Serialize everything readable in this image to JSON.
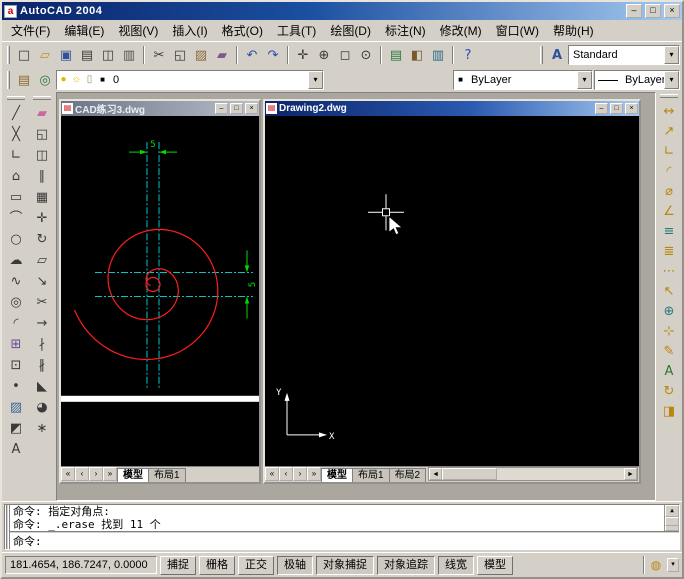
{
  "titlebar": {
    "title": "AutoCAD 2004",
    "icon_letter": "a",
    "min_glyph": "–",
    "restore_glyph": "□",
    "close_glyph": "×"
  },
  "menu": {
    "items": [
      {
        "n": "menu-file",
        "label": "文件(F)"
      },
      {
        "n": "menu-edit",
        "label": "编辑(E)"
      },
      {
        "n": "menu-view",
        "label": "视图(V)"
      },
      {
        "n": "menu-insert",
        "label": "插入(I)"
      },
      {
        "n": "menu-format",
        "label": "格式(O)"
      },
      {
        "n": "menu-tools",
        "label": "工具(T)"
      },
      {
        "n": "menu-draw",
        "label": "绘图(D)"
      },
      {
        "n": "menu-dimension",
        "label": "标注(N)"
      },
      {
        "n": "menu-modify",
        "label": "修改(M)"
      },
      {
        "n": "menu-window",
        "label": "窗口(W)"
      },
      {
        "n": "menu-help",
        "label": "帮助(H)"
      }
    ]
  },
  "standard_toolbar": [
    {
      "n": "qnew",
      "g": "□",
      "c": "#3a3a3a"
    },
    {
      "n": "open",
      "g": "▱",
      "c": "#c09020"
    },
    {
      "n": "save",
      "g": "▣",
      "c": "#31519b"
    },
    {
      "n": "plot",
      "g": "▤",
      "c": "#3a3a3a"
    },
    {
      "n": "plot-preview",
      "g": "◫",
      "c": "#3a3a3a"
    },
    {
      "n": "publish",
      "g": "▥",
      "c": "#555555"
    },
    {
      "sep": true
    },
    {
      "n": "cut",
      "g": "✂",
      "c": "#3a3a3a"
    },
    {
      "n": "copy-clip",
      "g": "◱",
      "c": "#3a3a3a"
    },
    {
      "n": "paste-clip",
      "g": "▨",
      "c": "#8a6d3b"
    },
    {
      "n": "match-properties",
      "g": "▰",
      "c": "#7a5a8a"
    },
    {
      "sep": true
    },
    {
      "n": "undo",
      "g": "↶",
      "c": "#2a4fb0"
    },
    {
      "n": "redo",
      "g": "↷",
      "c": "#2a4fb0"
    },
    {
      "sep": true
    },
    {
      "n": "pan-realtime",
      "g": "✛",
      "c": "#3a3a3a"
    },
    {
      "n": "zoom-realtime",
      "g": "⊕",
      "c": "#3a3a3a"
    },
    {
      "n": "zoom-window",
      "g": "◻",
      "c": "#3a3a3a"
    },
    {
      "n": "zoom-previous",
      "g": "⊙",
      "c": "#3a3a3a"
    },
    {
      "sep": true
    },
    {
      "n": "properties",
      "g": "▤",
      "c": "#2a7a3a"
    },
    {
      "n": "designcenter",
      "g": "◧",
      "c": "#7a5a2a"
    },
    {
      "n": "tool-palettes",
      "g": "▥",
      "c": "#2a6a8a"
    },
    {
      "sep": true
    },
    {
      "n": "help",
      "g": "?",
      "c": "#2a4fb0"
    }
  ],
  "styles_toolbar": {
    "text_style_glyph": "A",
    "value": "Standard",
    "arrow": "▾"
  },
  "layers_toolbar": {
    "layer_properties_glyph": "▤",
    "make_current_glyph": "◎",
    "bulb_glyph": "●",
    "sun_glyph": "☼",
    "lock_glyph": "▯",
    "swatch_glyph": "■",
    "current_layer": "0",
    "arrow": "▾"
  },
  "properties_toolbar": {
    "swatch_glyph": "■",
    "color_value": "ByLayer",
    "linetype_value": "ByLayer",
    "arrow": "▾"
  },
  "draw_toolbar": [
    {
      "n": "line",
      "g": "╱",
      "c": "#3a3a3a"
    },
    {
      "n": "construction-line",
      "g": "╳",
      "c": "#3a3a3a"
    },
    {
      "n": "polyline",
      "g": "∟",
      "c": "#3a3a3a"
    },
    {
      "n": "polygon",
      "g": "⌂",
      "c": "#3a3a3a"
    },
    {
      "n": "rectangle",
      "g": "▭",
      "c": "#3a3a3a"
    },
    {
      "n": "arc",
      "g": "⌒",
      "c": "#3a3a3a"
    },
    {
      "n": "circle",
      "g": "○",
      "c": "#3a3a3a"
    },
    {
      "n": "revision-cloud",
      "g": "☁",
      "c": "#3a3a3a"
    },
    {
      "n": "spline",
      "g": "∿",
      "c": "#3a3a3a"
    },
    {
      "n": "ellipse",
      "g": "◎",
      "c": "#3a3a3a"
    },
    {
      "n": "ellipse-arc",
      "g": "◜",
      "c": "#3a3a3a"
    },
    {
      "n": "insert-block",
      "g": "⊞",
      "c": "#6a4a9a"
    },
    {
      "n": "make-block",
      "g": "⊡",
      "c": "#3a3a3a"
    },
    {
      "n": "point",
      "g": "•",
      "c": "#3a3a3a"
    },
    {
      "n": "hatch",
      "g": "▨",
      "c": "#3a6a9a"
    },
    {
      "n": "region",
      "g": "◩",
      "c": "#3a3a3a"
    },
    {
      "n": "multiline-text",
      "g": "A",
      "c": "#3a3a3a"
    }
  ],
  "modify_toolbar": [
    {
      "n": "erase",
      "g": "▰",
      "c": "#c86a9a"
    },
    {
      "n": "copy-object",
      "g": "◱",
      "c": "#3a3a3a"
    },
    {
      "n": "mirror",
      "g": "◫",
      "c": "#3a3a3a"
    },
    {
      "n": "offset",
      "g": "∥",
      "c": "#3a3a3a"
    },
    {
      "n": "array",
      "g": "▦",
      "c": "#3a3a3a"
    },
    {
      "n": "move",
      "g": "✛",
      "c": "#3a3a3a"
    },
    {
      "n": "rotate",
      "g": "↻",
      "c": "#3a3a3a"
    },
    {
      "n": "scale",
      "g": "▱",
      "c": "#3a3a3a"
    },
    {
      "n": "stretch",
      "g": "↘",
      "c": "#3a3a3a"
    },
    {
      "n": "trim",
      "g": "✂",
      "c": "#3a3a3a"
    },
    {
      "n": "extend",
      "g": "→",
      "c": "#3a3a3a"
    },
    {
      "n": "break-at-point",
      "g": "∤",
      "c": "#3a3a3a"
    },
    {
      "n": "break",
      "g": "∦",
      "c": "#3a3a3a"
    },
    {
      "n": "chamfer",
      "g": "◣",
      "c": "#3a3a3a"
    },
    {
      "n": "fillet",
      "g": "◕",
      "c": "#3a3a3a"
    },
    {
      "n": "explode",
      "g": "∗",
      "c": "#3a3a3a"
    }
  ],
  "dimension_toolbar": [
    {
      "n": "linear-dimension",
      "g": "↔",
      "c": "#b8860b"
    },
    {
      "n": "aligned-dimension",
      "g": "↗",
      "c": "#b8860b"
    },
    {
      "n": "ordinate-dimension",
      "g": "∟",
      "c": "#b8860b"
    },
    {
      "n": "radius-dimension",
      "g": "◜",
      "c": "#b8860b"
    },
    {
      "n": "diameter-dimension",
      "g": "⌀",
      "c": "#b8860b"
    },
    {
      "n": "angular-dimension",
      "g": "∠",
      "c": "#b8860b"
    },
    {
      "n": "quick-dimension",
      "g": "≡",
      "c": "#2a7a7a"
    },
    {
      "n": "baseline-dimension",
      "g": "≣",
      "c": "#b8860b"
    },
    {
      "n": "continue-dimension",
      "g": "⋯",
      "c": "#b8860b"
    },
    {
      "n": "quick-leader",
      "g": "↖",
      "c": "#b8860b"
    },
    {
      "n": "tolerance",
      "g": "⊕",
      "c": "#2a7a7a"
    },
    {
      "n": "center-mark",
      "g": "⊹",
      "c": "#b8860b"
    },
    {
      "n": "dimension-edit",
      "g": "✎",
      "c": "#b8860b"
    },
    {
      "n": "dimension-text-edit",
      "g": "A",
      "c": "#2a7a2a"
    },
    {
      "n": "dimension-update",
      "g": "↻",
      "c": "#b8860b"
    },
    {
      "n": "dimension-style",
      "g": "◨",
      "c": "#b8860b"
    }
  ],
  "tab_nav": [
    {
      "n": "tab-scroll-first",
      "g": "«"
    },
    {
      "n": "tab-scroll-prev",
      "g": "‹"
    },
    {
      "n": "tab-scroll-next",
      "g": "›"
    },
    {
      "n": "tab-scroll-last",
      "g": "»"
    }
  ],
  "hscroll": {
    "left": "◄",
    "right": "►"
  },
  "windows": [
    {
      "title": "CAD练习3.dwg",
      "icon_glyph": "▤"
    },
    {
      "title": "Drawing2.dwg",
      "icon_glyph": "▤"
    }
  ],
  "tabs1": [
    {
      "n": "cad3-model-tab",
      "label": "模型",
      "active": true
    },
    {
      "n": "cad3-layout1-tab",
      "label": "布局1"
    }
  ],
  "tabs2": [
    {
      "n": "dwg2-model-tab",
      "label": "模型",
      "active": true
    },
    {
      "n": "dwg2-layout1-tab",
      "label": "布局1"
    },
    {
      "n": "dwg2-layout2-tab",
      "label": "布局2"
    }
  ],
  "drawing1": {
    "dim_top": "5",
    "dim_right": "5",
    "colors": {
      "entity": "#ff1e1e",
      "centerline": "#00c8c8",
      "dimension": "#00dc00",
      "paper": "#ffffff"
    }
  },
  "drawing2": {
    "ucs_x": "X",
    "ucs_y": "Y"
  },
  "command": {
    "lines": [
      "命令: 指定对角点:",
      "命令: _.erase 找到 11 个"
    ],
    "prompt": "命令:",
    "scroll_up": "▲",
    "scroll_down": "▼"
  },
  "status": {
    "coords": "181.4654, 186.7247, 0.0000",
    "toggles": [
      {
        "n": "snap-toggle",
        "label": "捕捉",
        "pressed": false
      },
      {
        "n": "grid-toggle",
        "label": "栅格",
        "pressed": false
      },
      {
        "n": "ortho-toggle",
        "label": "正交",
        "pressed": false
      },
      {
        "n": "polar-toggle",
        "label": "极轴",
        "pressed": true
      },
      {
        "n": "osnap-toggle",
        "label": "对象捕捉",
        "pressed": true
      },
      {
        "n": "otrack-toggle",
        "label": "对象追踪",
        "pressed": true
      },
      {
        "n": "lwt-toggle",
        "label": "线宽",
        "pressed": true
      },
      {
        "n": "model-toggle",
        "label": "模型",
        "pressed": false
      }
    ],
    "tray_icon_glyph": "◍",
    "tray_arrow": "▾"
  }
}
